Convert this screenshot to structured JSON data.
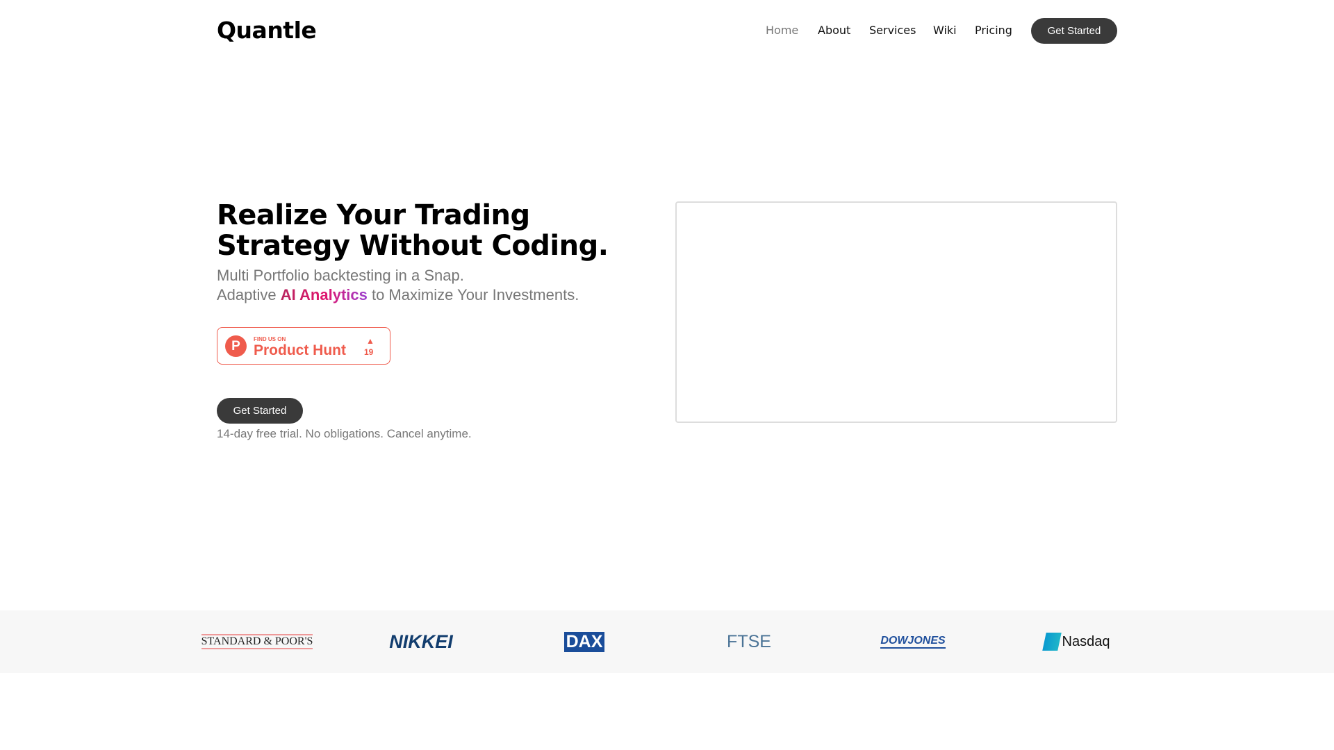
{
  "header": {
    "logo": "Quantle",
    "nav": [
      "Home",
      "About",
      "Services",
      "Wiki",
      "Pricing"
    ],
    "cta": "Get Started"
  },
  "hero": {
    "title": "Realize Your Trading Strategy Without Coding.",
    "subtitle1": "Multi Portfolio backtesting in a Snap.",
    "subtitle2_pre": "Adaptive ",
    "subtitle2_highlight": "AI Analytics",
    "subtitle2_post": " to Maximize Your Investments.",
    "cta": "Get Started",
    "trial_note": "14-day free trial. No obligations. Cancel anytime."
  },
  "product_hunt": {
    "find": "FIND US ON",
    "name": "Product Hunt",
    "letter": "P",
    "upvotes": "19",
    "color": "#ef5b4c"
  },
  "logos": [
    "STANDARD & POOR'S",
    "NIKKEI",
    "DAX",
    "FTSE",
    "DOWJONES",
    "Nasdaq"
  ]
}
